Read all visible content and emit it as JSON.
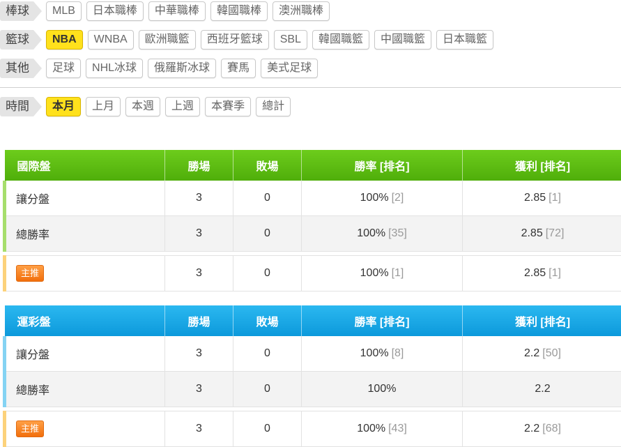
{
  "filters": {
    "baseball": {
      "label": "棒球",
      "options": [
        "MLB",
        "日本職棒",
        "中華職棒",
        "韓國職棒",
        "澳洲職棒"
      ]
    },
    "basketball": {
      "label": "籃球",
      "options": [
        "NBA",
        "WNBA",
        "歐洲職籃",
        "西班牙籃球",
        "SBL",
        "韓國職籃",
        "中國職籃",
        "日本職籃"
      ],
      "active": "NBA"
    },
    "other": {
      "label": "其他",
      "options": [
        "足球",
        "NHL冰球",
        "俄羅斯冰球",
        "賽馬",
        "美式足球"
      ]
    },
    "time": {
      "label": "時間",
      "options": [
        "本月",
        "上月",
        "本週",
        "上週",
        "本賽季",
        "總計"
      ],
      "active": "本月"
    }
  },
  "tables": {
    "intl": {
      "headers": [
        "國際盤",
        "勝場",
        "敗場",
        "勝率 [排名]",
        "獲利 [排名]"
      ],
      "rows": [
        {
          "label": "讓分盤",
          "wins": "3",
          "losses": "0",
          "rate": "100%",
          "rate_rank": "[2]",
          "profit": "2.85",
          "profit_rank": "[1]"
        },
        {
          "label": "總勝率",
          "wins": "3",
          "losses": "0",
          "rate": "100%",
          "rate_rank": "[35]",
          "profit": "2.85",
          "profit_rank": "[72]"
        }
      ],
      "main": {
        "badge": "主推",
        "wins": "3",
        "losses": "0",
        "rate": "100%",
        "rate_rank": "[1]",
        "profit": "2.85",
        "profit_rank": "[1]"
      }
    },
    "lottery": {
      "headers": [
        "運彩盤",
        "勝場",
        "敗場",
        "勝率 [排名]",
        "獲利 [排名]"
      ],
      "rows": [
        {
          "label": "讓分盤",
          "wins": "3",
          "losses": "0",
          "rate": "100%",
          "rate_rank": "[8]",
          "profit": "2.2",
          "profit_rank": "[50]"
        },
        {
          "label": "總勝率",
          "wins": "3",
          "losses": "0",
          "rate": "100%",
          "rate_rank": "",
          "profit": "2.2",
          "profit_rank": ""
        }
      ],
      "main": {
        "badge": "主推",
        "wins": "3",
        "losses": "0",
        "rate": "100%",
        "rate_rank": "[43]",
        "profit": "2.2",
        "profit_rank": "[68]"
      }
    }
  },
  "colors": {
    "active_chip": "#ffe11c",
    "intl_header": "#5cb811",
    "lottery_header": "#17a6e4",
    "badge": "#f57f1c"
  }
}
